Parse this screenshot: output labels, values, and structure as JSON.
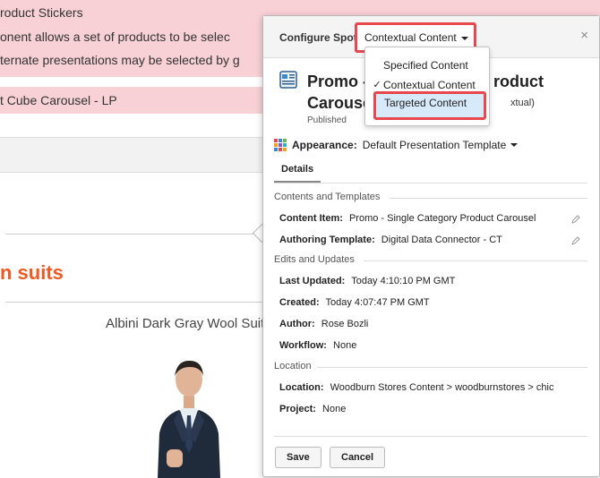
{
  "background": {
    "line1": "roduct Stickers",
    "line2": "onent allows a set of products to be selec",
    "line3": "ternate presentations may be selected by g",
    "line4": "t Cube Carousel - LP",
    "section_heading": "n suits",
    "product_caption": "Albini Dark Gray Wool Suit"
  },
  "dialog": {
    "header_title": "Configure Spot",
    "content_select_label": "Contextual Content",
    "close_glyph": "×",
    "title_line1": "Promo -",
    "title_line1_tail": "roduct",
    "title_line2": "Carouse",
    "title_suffix": "xtual)",
    "status": "Published",
    "appearance_label": "Appearance:",
    "appearance_value": "Default Presentation Template",
    "tab_details": "Details",
    "sections": {
      "contents": "Contents and Templates",
      "edits": "Edits and Updates",
      "location": "Location"
    },
    "fields": {
      "content_item_label": "Content Item:",
      "content_item_value": "Promo - Single Category Product Carousel",
      "authoring_template_label": "Authoring Template:",
      "authoring_template_value": "Digital Data Connector - CT",
      "last_updated_label": "Last Updated:",
      "last_updated_value": "Today 4:10:10 PM GMT",
      "created_label": "Created:",
      "created_value": "Today 4:07:47 PM GMT",
      "author_label": "Author:",
      "author_value": "Rose Bozli",
      "workflow_label": "Workflow:",
      "workflow_value": "None",
      "location_label": "Location:",
      "location_value": "Woodburn Stores Content > woodburnstores > chic",
      "project_label": "Project:",
      "project_value": "None"
    },
    "buttons": {
      "save": "Save",
      "cancel": "Cancel"
    }
  },
  "menu": {
    "items": [
      {
        "label": "Specified Content",
        "checked": false
      },
      {
        "label": "Contextual Content",
        "checked": true
      },
      {
        "label": "Targeted Content",
        "checked": false
      }
    ],
    "check_glyph": "✓"
  },
  "colors": {
    "highlight_border": "#e8474e",
    "accent_orange": "#f05a22",
    "pink_band": "#f8d1d6"
  }
}
